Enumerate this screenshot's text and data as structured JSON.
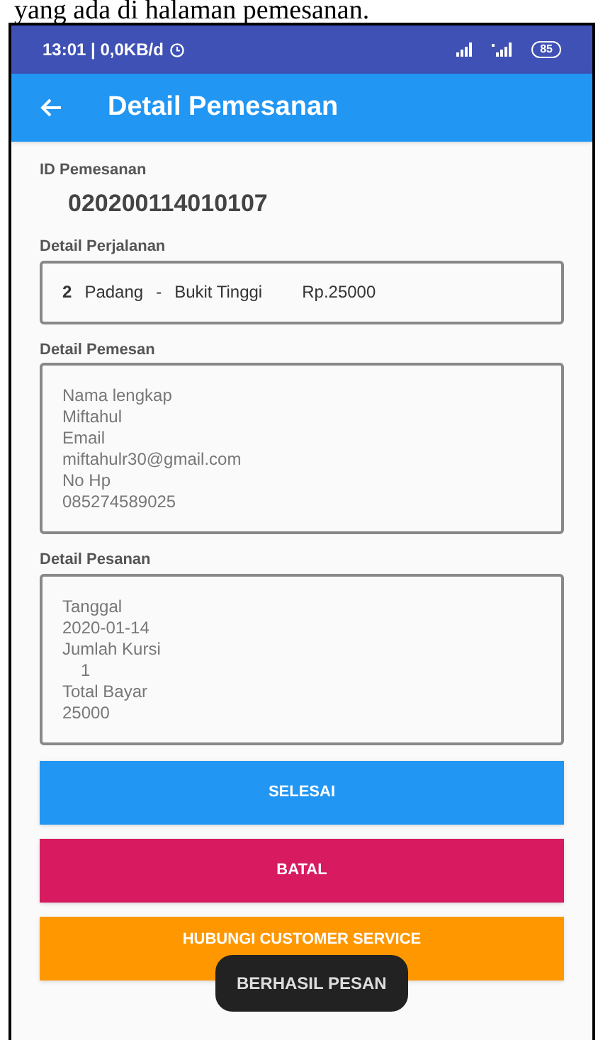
{
  "caption": "yang ada di halaman pemesanan.",
  "status_bar": {
    "time": "13:01 | 0,0KB/d",
    "battery": "85"
  },
  "app_bar": {
    "title": "Detail Pemesanan"
  },
  "order_id": {
    "label": "ID Pemesanan",
    "value": "020200114010107"
  },
  "sections": [
    {
      "label": "Detail Perjalanan",
      "kind": "route",
      "seats": "2",
      "origin": "Padang",
      "separator": "-",
      "destination": "Bukit Tinggi",
      "price": "Rp.25000"
    },
    {
      "label": "Detail Pemesan",
      "kind": "lines",
      "lines": [
        {
          "text": "Nama lengkap",
          "indented": false
        },
        {
          "text": "Miftahul",
          "indented": false
        },
        {
          "text": "Email",
          "indented": false
        },
        {
          "text": "miftahulr30@gmail.com",
          "indented": false
        },
        {
          "text": "No Hp",
          "indented": false
        },
        {
          "text": "085274589025",
          "indented": false
        }
      ]
    },
    {
      "label": "Detail Pesanan",
      "kind": "lines",
      "lines": [
        {
          "text": "Tanggal",
          "indented": false
        },
        {
          "text": "2020-01-14",
          "indented": false
        },
        {
          "text": "Jumlah Kursi",
          "indented": false
        },
        {
          "text": "1",
          "indented": true
        },
        {
          "text": "Total Bayar",
          "indented": false
        },
        {
          "text": "25000",
          "indented": false
        }
      ]
    }
  ],
  "buttons": [
    {
      "label": "SELESAI",
      "color": "#2196f3"
    },
    {
      "label": "BATAL",
      "color": "#d81b60"
    },
    {
      "label": "HUBUNGI CUSTOMER SERVICE",
      "color": "#ff9800"
    }
  ],
  "toast": "BERHASIL PESAN"
}
